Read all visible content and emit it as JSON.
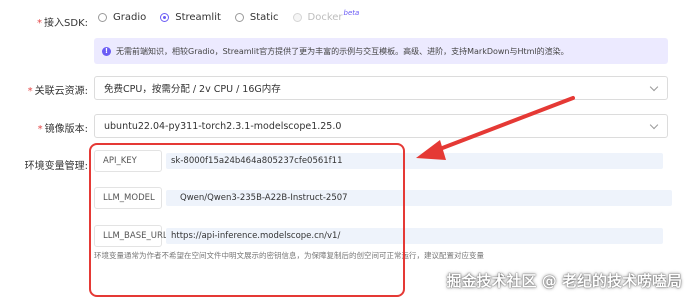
{
  "sdk": {
    "label": "接入SDK:",
    "options": [
      {
        "label": "Gradio"
      },
      {
        "label": "Streamlit"
      },
      {
        "label": "Static"
      },
      {
        "label": "Docker",
        "badge": "beta"
      }
    ],
    "selected": "Streamlit"
  },
  "banner": {
    "text": "无需前端知识，相较Gradio，Streamlit官方提供了更为丰富的示例与交互模板。高级、进阶，支持MarkDown与Html的渲染。"
  },
  "cloud": {
    "label": "关联云资源:",
    "value": "免费CPU，按需分配 / 2v CPU / 16G内存"
  },
  "image": {
    "label": "镜像版本:",
    "value": "ubuntu22.04-py311-torch2.3.1-modelscope1.25.0"
  },
  "env": {
    "label": "环境变量管理:",
    "rows": [
      {
        "key": "API_KEY",
        "value": "sk-8000f15a24b464a805237cfe0561f11"
      },
      {
        "key": "LLM_MODEL",
        "value": "Qwen/Qwen3-235B-A22B-Instruct-2507"
      },
      {
        "key": "LLM_BASE_URL",
        "value": "https://api-inference.modelscope.cn/v1/"
      }
    ],
    "hint": "环境变量通常为作者不希望在空间文件中明文展示的密钥信息，为保障复制后的创空间可正常运行，建议配置对应变量"
  },
  "watermark": "掘金技术社区 @ 老纪的技术唠嗑局",
  "colors": {
    "accent": "#6b5cf5",
    "annotation": "#e53935",
    "banner_bg": "#eceaff"
  }
}
